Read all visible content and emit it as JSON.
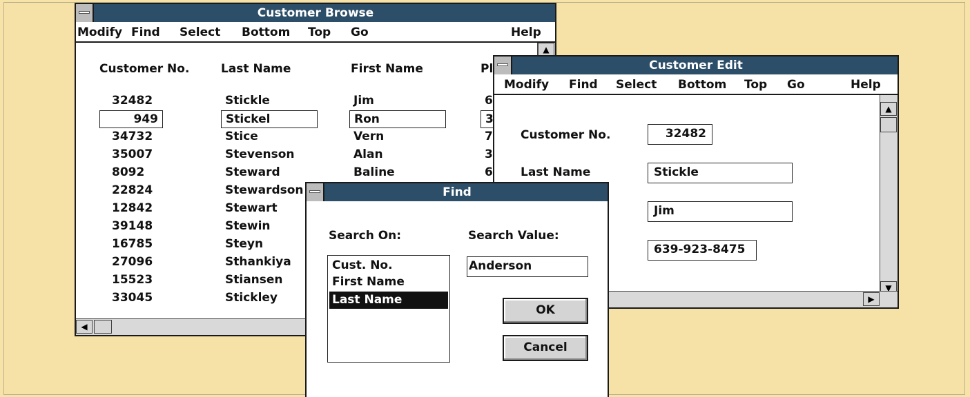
{
  "browse": {
    "title": "Customer Browse",
    "menu": [
      {
        "label": "Modify"
      },
      {
        "label": "Find"
      },
      {
        "label": "Select"
      },
      {
        "label": "Bottom"
      },
      {
        "label": "Top"
      },
      {
        "label": "Go"
      },
      {
        "label": "Help"
      }
    ],
    "columns": [
      "Customer No.",
      "Last Name",
      "First Name",
      "Pl"
    ],
    "rows": [
      {
        "no": "32482",
        "last": "Stickle",
        "first": "Jim",
        "ph": "6"
      },
      {
        "no": "949",
        "last": "Stickel",
        "first": "Ron",
        "ph": "3"
      },
      {
        "no": "34732",
        "last": "Stice",
        "first": "Vern",
        "ph": "7"
      },
      {
        "no": "35007",
        "last": "Stevenson",
        "first": "Alan",
        "ph": "3"
      },
      {
        "no": "8092",
        "last": "Steward",
        "first": "Baline",
        "ph": "6"
      },
      {
        "no": "22824",
        "last": "Stewardson",
        "first": "",
        "ph": ""
      },
      {
        "no": "12842",
        "last": "Stewart",
        "first": "",
        "ph": ""
      },
      {
        "no": "39148",
        "last": "Stewin",
        "first": "",
        "ph": ""
      },
      {
        "no": "16785",
        "last": "Steyn",
        "first": "",
        "ph": ""
      },
      {
        "no": "27096",
        "last": "Sthankiya",
        "first": "",
        "ph": ""
      },
      {
        "no": "15523",
        "last": "Stiansen",
        "first": "",
        "ph": ""
      },
      {
        "no": "33045",
        "last": "Stickley",
        "first": "",
        "ph": ""
      }
    ],
    "selected_row": 1
  },
  "edit": {
    "title": "Customer Edit",
    "menu": [
      {
        "label": "Modify"
      },
      {
        "label": "Find"
      },
      {
        "label": "Select"
      },
      {
        "label": "Bottom"
      },
      {
        "label": "Top"
      },
      {
        "label": "Go"
      },
      {
        "label": "Help"
      }
    ],
    "customer_no_label": "Customer No.",
    "customer_no_value": "32482",
    "last_name_label": "Last Name",
    "last_name_value": "Stickle",
    "first_name_value": "Jim",
    "phone_value": "639-923-8475"
  },
  "find": {
    "title": "Find",
    "search_on_label": "Search On:",
    "search_value_label": "Search Value:",
    "options": [
      "Cust. No.",
      "First Name",
      "Last Name"
    ],
    "selected_option": "Last Name",
    "search_value": "Anderson",
    "ok_label": "OK",
    "cancel_label": "Cancel"
  },
  "icons": {
    "system_menu": "system-menu-icon",
    "scroll_up": "arrow-up-icon",
    "scroll_down": "arrow-down-icon",
    "scroll_left": "arrow-left-icon",
    "scroll_right": "arrow-right-icon"
  },
  "colors": {
    "background": "#f7e3a8",
    "titlebar": "#2d4e68",
    "selection": "#111111"
  }
}
